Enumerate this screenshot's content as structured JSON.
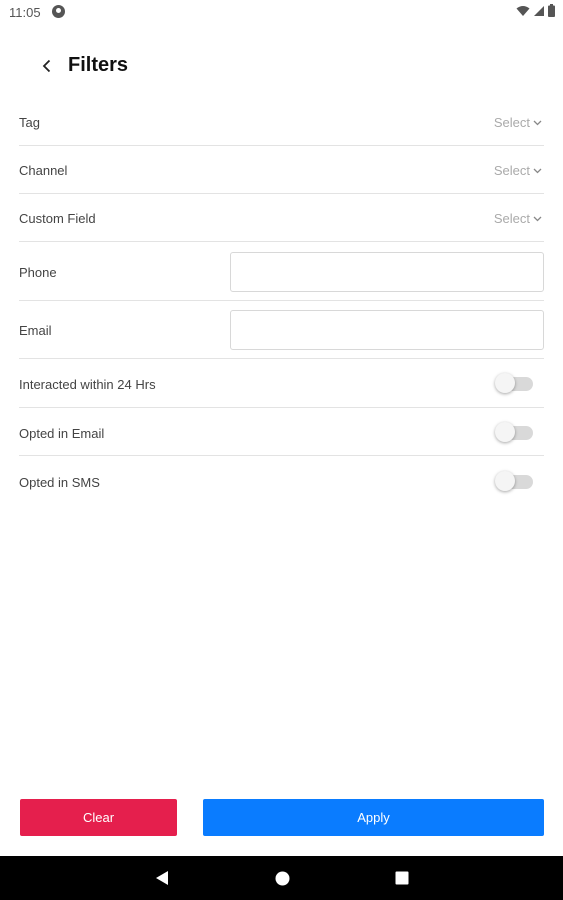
{
  "status_bar": {
    "time": "11:05",
    "icons": [
      "app-notification-icon",
      "wifi-icon",
      "cell-signal-icon",
      "battery-icon"
    ]
  },
  "header": {
    "back_icon": "chevron-left-icon",
    "title": "Filters"
  },
  "filters": {
    "tag": {
      "label": "Tag",
      "value": "Select"
    },
    "channel": {
      "label": "Channel",
      "value": "Select"
    },
    "custom_field": {
      "label": "Custom Field",
      "value": "Select"
    },
    "phone": {
      "label": "Phone",
      "value": "",
      "placeholder": ""
    },
    "email": {
      "label": "Email",
      "value": "",
      "placeholder": ""
    },
    "interacted": {
      "label": "Interacted within 24 Hrs",
      "on": false
    },
    "opted_email": {
      "label": "Opted in Email",
      "on": false
    },
    "opted_sms": {
      "label": "Opted in SMS",
      "on": false
    }
  },
  "actions": {
    "clear_label": "Clear",
    "apply_label": "Apply"
  },
  "colors": {
    "clear": "#e51f4d",
    "apply": "#0a7cff",
    "select_text": "#aaaaaa",
    "toggle_off": "#d9d9d9"
  },
  "nav_bar": {
    "icons": [
      "back-triangle-icon",
      "home-circle-icon",
      "recents-square-icon"
    ]
  }
}
